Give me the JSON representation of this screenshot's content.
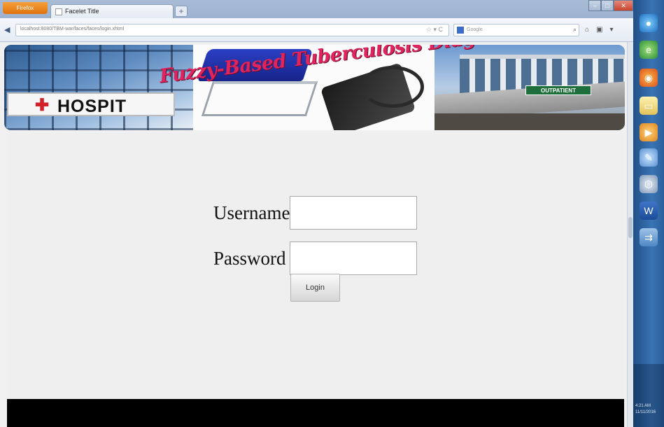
{
  "browser": {
    "menu_label": "Firefox",
    "tab_title": "Facelet Title",
    "new_tab": "+",
    "url": "localhost:8080/TBM-war/faces/faces/login.xhtml",
    "search_placeholder": "Google"
  },
  "banner": {
    "title": "Fuzzy-Based Tuberculosis Diagnosis System",
    "hospital_sign": "HOSPIT",
    "outpatient_sign": "OUTPATIENT"
  },
  "login_form": {
    "username_label": "Username",
    "password_label": "Password",
    "username_value": "",
    "password_value": "",
    "login_button": "Login"
  },
  "taskbar": {
    "clock_time": "4:21 AM",
    "clock_date": "11/11/2016"
  },
  "colors": {
    "banner_title": "#e0245e",
    "page_background": "#f0f0f0",
    "footer": "#000000"
  }
}
